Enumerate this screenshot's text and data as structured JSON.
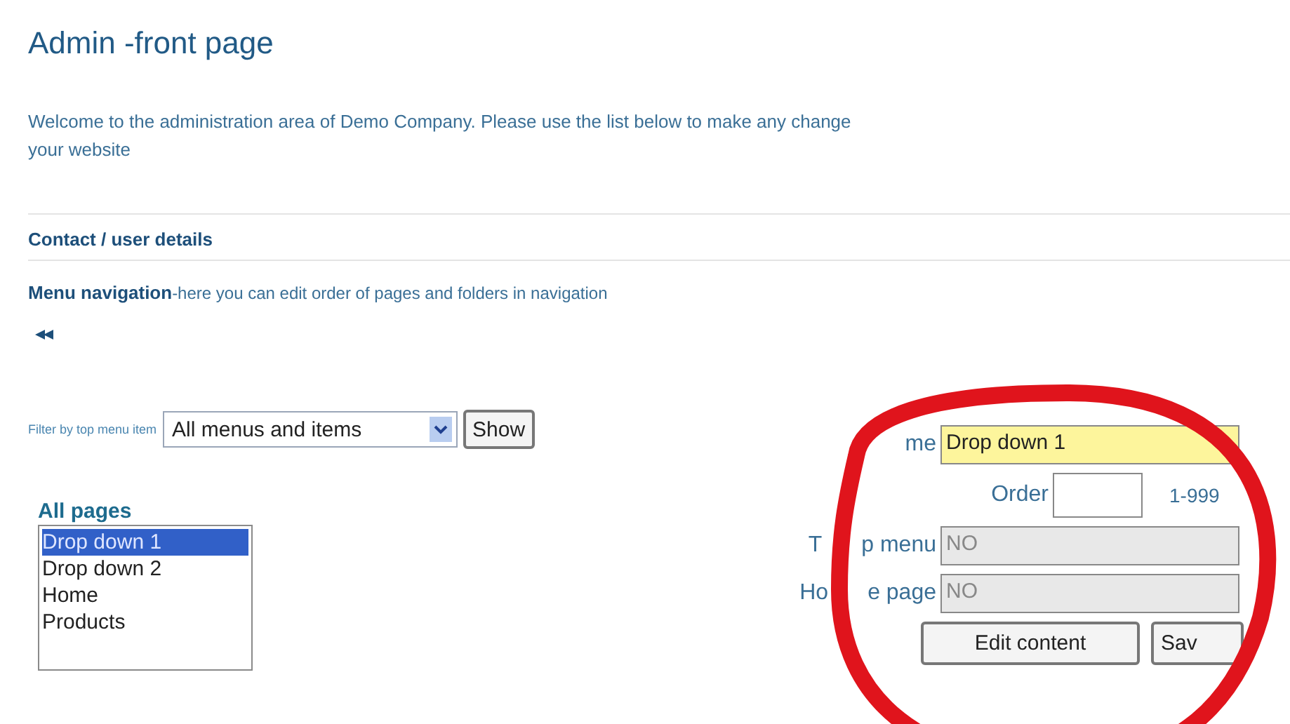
{
  "title": "Admin -front page",
  "welcome_lines": [
    "Welcome to the administration area of Demo Company. Please use the list below to make any change",
    "your website"
  ],
  "sections": [
    {
      "kind": "heading",
      "label": "Contact / user details"
    },
    {
      "kind": "described",
      "label": "Menu navigation",
      "description": "-here you can edit order of pages and folders in navigation"
    }
  ],
  "filter": {
    "label": "Filter by top menu item",
    "value": "All menus and items",
    "button": "Show"
  },
  "all_pages": {
    "heading": "All pages",
    "items": [
      {
        "label": "Drop down 1",
        "selected": true
      },
      {
        "label": "Drop down 2",
        "selected": false
      },
      {
        "label": "Home",
        "selected": false
      },
      {
        "label": "Products",
        "selected": false
      }
    ]
  },
  "form": {
    "fields": [
      {
        "kind": "text",
        "label_parts": [
          "me"
        ],
        "value": "Drop down 1",
        "disabled": false
      },
      {
        "kind": "short",
        "label_parts": [
          "Order"
        ],
        "hint": "1-999",
        "disabled": false
      },
      {
        "kind": "text",
        "label_parts": [
          "T",
          "p menu"
        ],
        "value": "NO",
        "disabled": true
      },
      {
        "kind": "text",
        "label_parts": [
          "Ho",
          "e page"
        ],
        "value": "NO",
        "disabled": true
      }
    ],
    "buttons": [
      "Edit content",
      "Sav"
    ]
  }
}
